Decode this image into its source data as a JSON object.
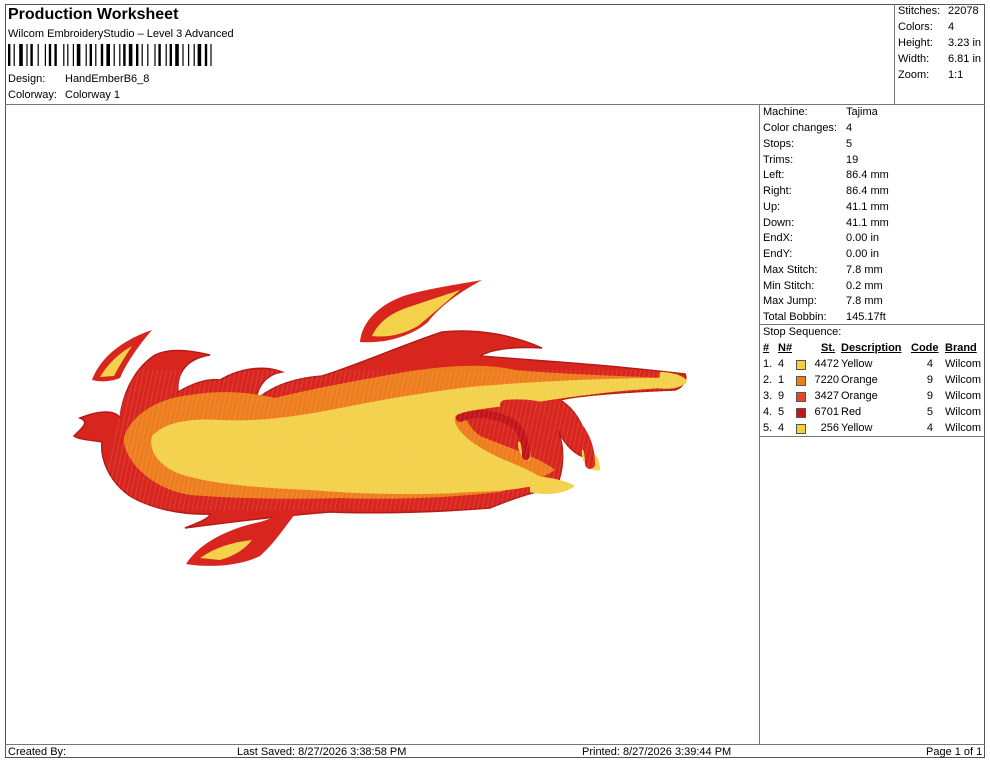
{
  "header": {
    "title": "Production Worksheet",
    "subtitle": "Wilcom EmbroideryStudio – Level 3 Advanced",
    "design_label": "Design:",
    "design_value": "HandEmberB6_8",
    "colorway_label": "Colorway:",
    "colorway_value": "Colorway 1"
  },
  "summary": [
    {
      "label": "Stitches:",
      "value": "22078"
    },
    {
      "label": "Colors:",
      "value": "4"
    },
    {
      "label": "Height:",
      "value": "3.23 in"
    },
    {
      "label": "Width:",
      "value": "6.81 in"
    },
    {
      "label": "Zoom:",
      "value": "1:1"
    }
  ],
  "details": [
    {
      "label": "Machine:",
      "value": "Tajima"
    },
    {
      "label": "Color changes:",
      "value": "4"
    },
    {
      "label": "Stops:",
      "value": "5"
    },
    {
      "label": "Trims:",
      "value": "19"
    },
    {
      "label": "Left:",
      "value": "86.4 mm"
    },
    {
      "label": "Right:",
      "value": "86.4 mm"
    },
    {
      "label": "Up:",
      "value": "41.1 mm"
    },
    {
      "label": "Down:",
      "value": "41.1 mm"
    },
    {
      "label": "EndX:",
      "value": "0.00 in"
    },
    {
      "label": "EndY:",
      "value": "0.00 in"
    },
    {
      "label": "Max Stitch:",
      "value": "7.8 mm"
    },
    {
      "label": "Min Stitch:",
      "value": "0.2 mm"
    },
    {
      "label": "Max Jump:",
      "value": "7.8 mm"
    },
    {
      "label": "Total Bobbin:",
      "value": "145.17ft"
    }
  ],
  "stop_sequence": {
    "title": "Stop Sequence:",
    "headers": {
      "num": "#",
      "n": "N#",
      "st": "St.",
      "desc": "Description",
      "code": "Code",
      "brand": "Brand"
    },
    "rows": [
      {
        "num": "1.",
        "n": "4",
        "color": "#f5cf3f",
        "st": "4472",
        "desc": "Yellow",
        "code": "4",
        "brand": "Wilcom"
      },
      {
        "num": "2.",
        "n": "1",
        "color": "#ee7d1e",
        "st": "7220",
        "desc": "Orange",
        "code": "9",
        "brand": "Wilcom"
      },
      {
        "num": "3.",
        "n": "9",
        "color": "#e8462a",
        "st": "3427",
        "desc": "Orange",
        "code": "9",
        "brand": "Wilcom"
      },
      {
        "num": "4.",
        "n": "5",
        "color": "#c3141a",
        "st": "6701",
        "desc": "Red",
        "code": "5",
        "brand": "Wilcom"
      },
      {
        "num": "5.",
        "n": "4",
        "color": "#f5cf3f",
        "st": "256",
        "desc": "Yellow",
        "code": "4",
        "brand": "Wilcom"
      }
    ]
  },
  "footer": {
    "created_by": "Created By:",
    "last_saved": "Last Saved: 8/27/2026 3:38:58 PM",
    "printed": "Printed: 8/27/2026 3:39:44 PM",
    "page": "Page 1 of 1"
  },
  "colors": {
    "red": "#d8261f",
    "orange": "#ee7d1e",
    "yellow": "#f3d14a"
  }
}
